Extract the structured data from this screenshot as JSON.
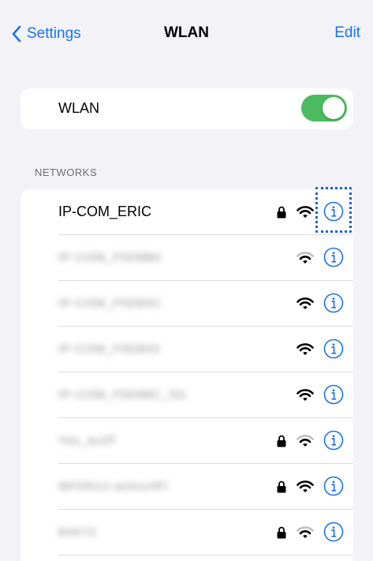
{
  "navbar": {
    "back_label": "Settings",
    "title": "WLAN",
    "edit_label": "Edit"
  },
  "wlan": {
    "label": "WLAN",
    "enabled": true
  },
  "networks": {
    "header": "NETWORKS",
    "items": [
      {
        "name": "IP-COM_ERIC",
        "secured": true,
        "signal": "full",
        "blurred": false,
        "selected": true
      },
      {
        "name": "IP-COM_F5D8B0",
        "secured": false,
        "signal": "weak",
        "blurred": true
      },
      {
        "name": "IP-COM_F5D84C",
        "secured": false,
        "signal": "full",
        "blurred": true
      },
      {
        "name": "IP-COM_F5D843",
        "secured": false,
        "signal": "full",
        "blurred": true
      },
      {
        "name": "IP-COM_F5D88C_5G",
        "secured": false,
        "signal": "full",
        "blurred": true
      },
      {
        "name": "Yes_ac2F",
        "secured": true,
        "signal": "weak",
        "blurred": true
      },
      {
        "name": "WFD512-achcu4Fi",
        "secured": true,
        "signal": "full",
        "blurred": true
      },
      {
        "name": "84A72",
        "secured": true,
        "signal": "weak",
        "blurred": true
      }
    ]
  },
  "colors": {
    "accent": "#1a73e8",
    "toggle_on": "#4cbb5f",
    "background": "#f2f2f7"
  },
  "icons": {
    "back": "chevron-left-icon",
    "lock": "lock-icon",
    "wifi": "wifi-icon",
    "info": "info-icon"
  }
}
